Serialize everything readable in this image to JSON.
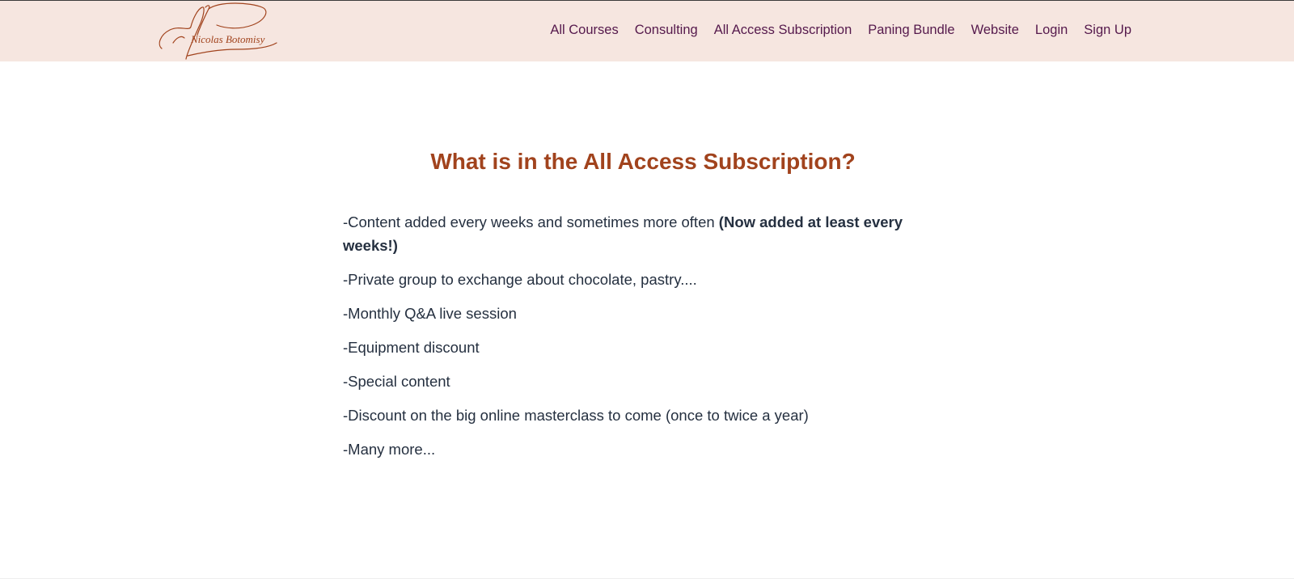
{
  "brand": {
    "logo_text": "Nicolas Botomisy",
    "logo_color": "#a1431d"
  },
  "nav": {
    "links": [
      "All Courses",
      "Consulting",
      "All Access Subscription",
      "Paning Bundle",
      "Website",
      "Login",
      "Sign Up"
    ],
    "link_color": "#55194c",
    "background": "#f6e6e0"
  },
  "main": {
    "heading": "What is in the All Access Subscription?",
    "heading_color": "#a1431d",
    "features": {
      "item0": {
        "text": "-Content added every weeks and sometimes more often ",
        "bold": "(Now added at least every weeks!)"
      },
      "item1": "-Private group to exchange about chocolate, pastry....",
      "item2": "-Monthly Q&A live session",
      "item3": "-Equipment discount",
      "item4": "-Special content",
      "item5": "-Discount on the big online masterclass to come (once to twice a year)",
      "item6": "-Many more..."
    }
  }
}
